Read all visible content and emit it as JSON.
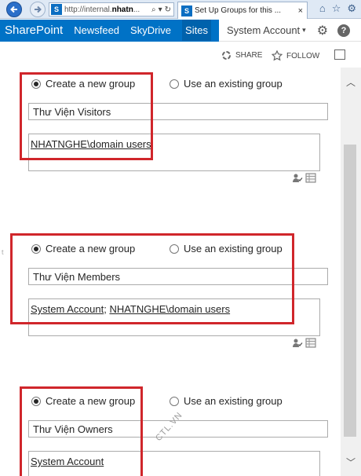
{
  "browser": {
    "address_url_prefix": "http://internal.",
    "address_url_bold": "nhatn",
    "address_url_suffix": "...",
    "tab_title": "Set Up Groups for this ...",
    "tab_close": "×"
  },
  "suite": {
    "brand": "SharePoint",
    "links": [
      "Newsfeed",
      "SkyDrive",
      "Sites"
    ],
    "user": "System Account",
    "help": "?"
  },
  "actions": {
    "share": "SHARE",
    "follow": "FOLLOW"
  },
  "groups": [
    {
      "create_label": "Create a new group",
      "existing_label": "Use an existing group",
      "group_name": "Thư Viện Visitors",
      "members": [
        "NHATNGHE\\domain users"
      ]
    },
    {
      "create_label": "Create a new group",
      "existing_label": "Use an existing group",
      "group_name": "Thư Viện Members",
      "members": [
        "System Account",
        "NHATNGHE\\domain users"
      ],
      "separator": "; "
    },
    {
      "create_label": "Create a new group",
      "existing_label": "Use an existing group",
      "group_name": "Thư Viện Owners",
      "members": [
        "System Account"
      ]
    }
  ],
  "watermark": "CTL.VN",
  "colors": {
    "suite_blue": "#0072c6",
    "highlight_red": "#d0262b"
  },
  "icons": [
    "back-arrow-icon",
    "forward-arrow-icon",
    "search-icon",
    "dropdown-icon",
    "refresh-icon",
    "home-icon",
    "star-icon",
    "gear-icon",
    "share-icon",
    "follow-star-icon",
    "focus-icon",
    "check-names-icon",
    "browse-address-book-icon",
    "scroll-up-icon",
    "scroll-down-icon"
  ]
}
